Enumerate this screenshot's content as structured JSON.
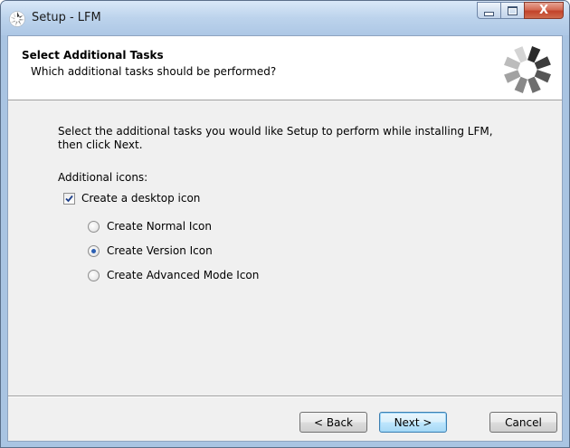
{
  "window": {
    "title": "Setup - LFM",
    "caption_buttons": {
      "minimize_icon": "minimize-icon",
      "maximize_icon": "maximize-icon",
      "close_icon": "close-icon",
      "close_glyph": "X"
    }
  },
  "header": {
    "title": "Select Additional Tasks",
    "subtitle": "Which additional tasks should be performed?",
    "icon": "installer-wizard-icon"
  },
  "body": {
    "instructions": "Select the additional tasks you would like Setup to perform while installing LFM, then click Next.",
    "group_label": "Additional icons:",
    "desktop_icon_checkbox": {
      "label": "Create a desktop icon",
      "checked": true
    },
    "icon_options": [
      {
        "label": "Create Normal Icon",
        "selected": false
      },
      {
        "label": "Create Version Icon",
        "selected": true
      },
      {
        "label": "Create Advanced Mode Icon",
        "selected": false
      }
    ]
  },
  "buttons": {
    "back": "< Back",
    "next": "Next >",
    "cancel": "Cancel"
  },
  "colors": {
    "title_bar": "#bcd3ec",
    "dialog_background": "#f0f0f0",
    "header_background": "#ffffff",
    "close_button": "#c2432a",
    "default_button_border": "#3c7fb1"
  }
}
